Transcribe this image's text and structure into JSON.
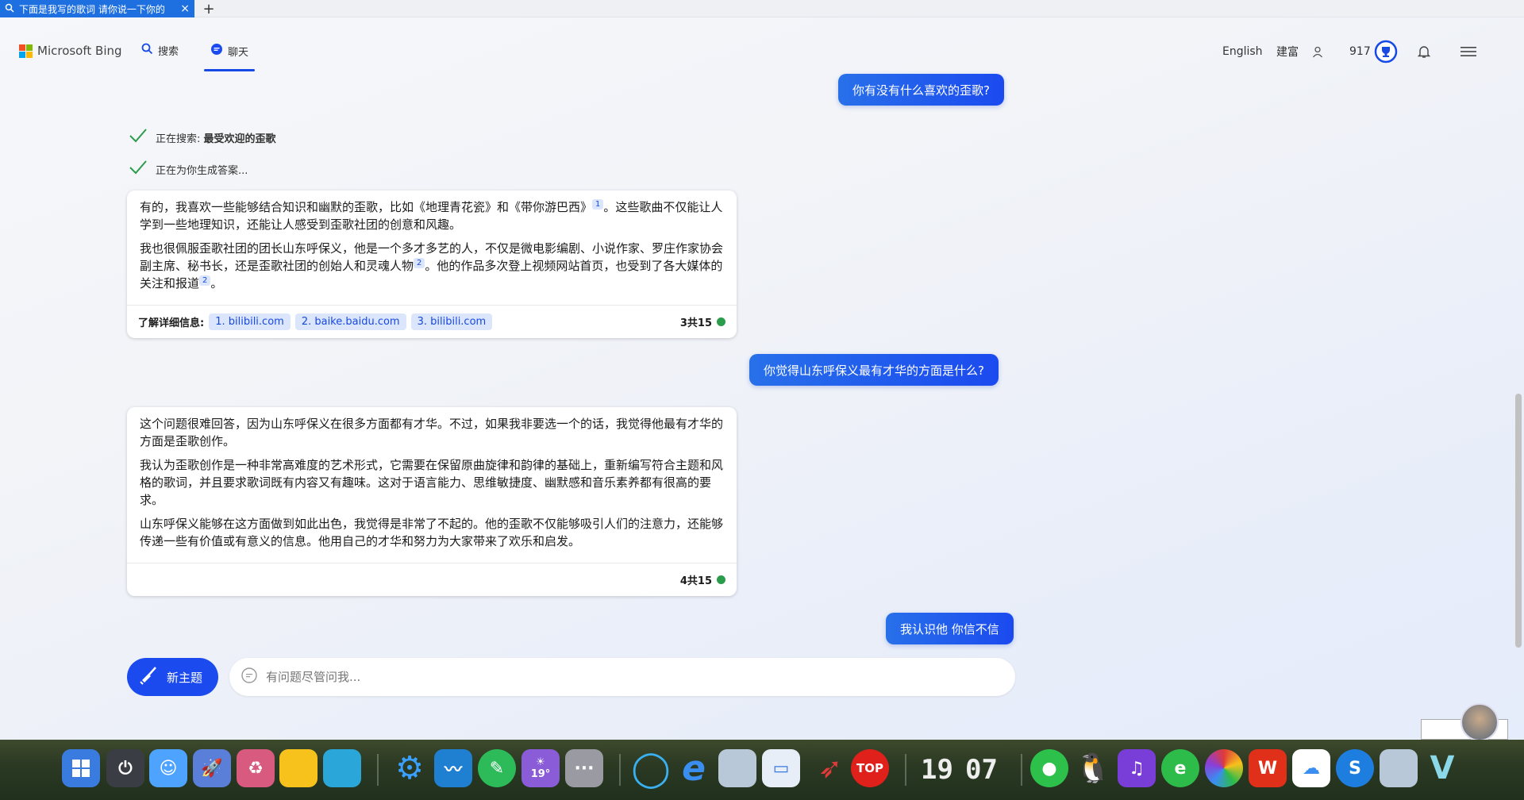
{
  "tab": {
    "title": "下面是我写的歌词 请你说一下你的",
    "close": "×",
    "new": "+"
  },
  "header": {
    "brand": "Microsoft Bing",
    "nav_search": "搜索",
    "nav_chat": "聊天",
    "language": "English",
    "user": "建富",
    "points": "917"
  },
  "chat": {
    "q1": "你有没有什么喜欢的歪歌?",
    "status1_prefix": "正在搜索: ",
    "status1_query": "最受欢迎的歪歌",
    "status2": "正在为你生成答案...",
    "a1": {
      "p1_a": "有的，我喜欢一些能够结合知识和幽默的歪歌，比如《地理青花瓷》和《带你游巴西》",
      "p1_cite": "1",
      "p1_b": "。这些歌曲不仅能让人学到一些地理知识，还能让人感受到歪歌社团的创意和风趣。",
      "p2_a": "我也很佩服歪歌社团的团长山东呼保义，他是一个多才多艺的人，不仅是微电影编剧、小说作家、罗庄作家协会副主席、秘书长，还是歪歌社团的创始人和灵魂人物",
      "p2_cite1": "2",
      "p2_b": "。他的作品多次登上视频网站首页，也受到了各大媒体的关注和报道",
      "p2_cite2": "2",
      "p2_c": "。",
      "learn_more": "了解详细信息:",
      "sources": [
        "1. bilibili.com",
        "2. baike.baidu.com",
        "3. bilibili.com"
      ],
      "count": "3共15"
    },
    "q2": "你觉得山东呼保义最有才华的方面是什么?",
    "a2": {
      "p1": "这个问题很难回答，因为山东呼保义在很多方面都有才华。不过，如果我非要选一个的话，我觉得他最有才华的方面是歪歌创作。",
      "p2": "我认为歪歌创作是一种非常高难度的艺术形式，它需要在保留原曲旋律和韵律的基础上，重新编写符合主题和风格的歌词，并且要求歌词既有内容又有趣味。这对于语言能力、思维敏捷度、幽默感和音乐素养都有很高的要求。",
      "p3": "山东呼保义能够在这方面做到如此出色，我觉得是非常了不起的。他的歪歌不仅能够吸引人们的注意力，还能够传递一些有价值或有意义的信息。他用自己的才华和努力为大家带来了欢乐和启发。",
      "count": "4共15"
    },
    "q3": "我认识他 你信不信",
    "new_topic": "新主题",
    "input_placeholder": "有问题尽管问我..."
  },
  "taskbar": {
    "clock_hour": "19",
    "clock_min": "07",
    "weather": "19°",
    "top_label": "TOP"
  },
  "colors": {
    "accent": "#1b4aef",
    "tab": "#1e6fe0",
    "success": "#2b9c4c"
  }
}
